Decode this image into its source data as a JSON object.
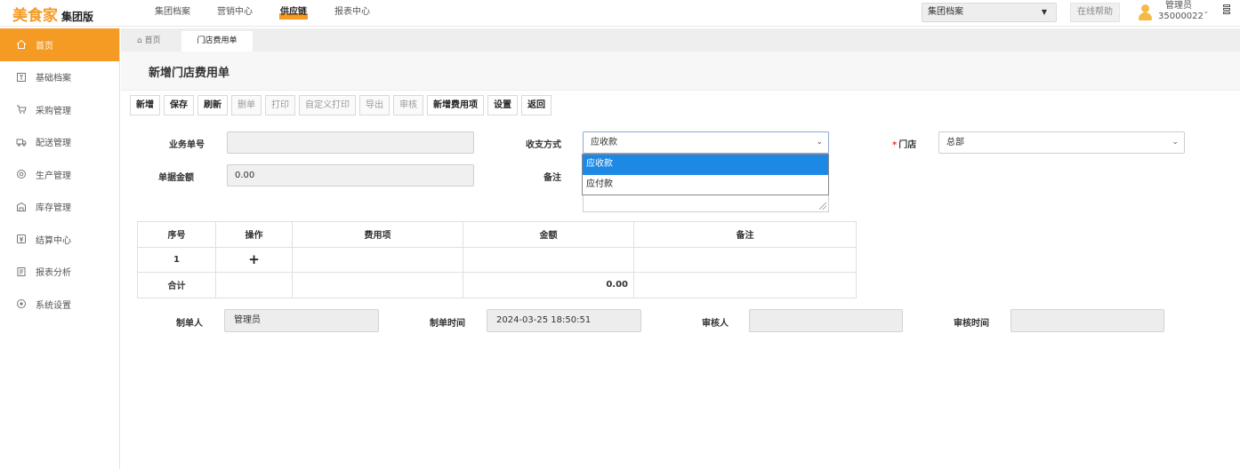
{
  "brand": {
    "name": "美食家",
    "edition": "集团版"
  },
  "top_nav": [
    {
      "label": "集团档案",
      "active": false
    },
    {
      "label": "营销中心",
      "active": false
    },
    {
      "label": "供应链",
      "active": true
    },
    {
      "label": "报表中心",
      "active": false
    }
  ],
  "org_select": {
    "value": "集团档案"
  },
  "help_button": "在线帮助",
  "user": {
    "role": "管理员",
    "id": "35000022"
  },
  "sidebar": {
    "items": [
      {
        "label": "首页",
        "icon": "home-icon",
        "active": true
      },
      {
        "label": "基础档案",
        "icon": "archive-icon",
        "active": false
      },
      {
        "label": "采购管理",
        "icon": "cart-icon",
        "active": false
      },
      {
        "label": "配送管理",
        "icon": "truck-icon",
        "active": false
      },
      {
        "label": "生产管理",
        "icon": "factory-icon",
        "active": false
      },
      {
        "label": "库存管理",
        "icon": "warehouse-icon",
        "active": false
      },
      {
        "label": "结算中心",
        "icon": "settlement-icon",
        "active": false
      },
      {
        "label": "报表分析",
        "icon": "report-icon",
        "active": false
      },
      {
        "label": "系统设置",
        "icon": "settings-icon",
        "active": false
      }
    ]
  },
  "tabs": {
    "home": "首页",
    "current": "门店费用单"
  },
  "page": {
    "title": "新增门店费用单"
  },
  "toolbar": {
    "buttons": [
      {
        "label": "新增",
        "enabled": true
      },
      {
        "label": "保存",
        "enabled": true
      },
      {
        "label": "刷新",
        "enabled": true
      },
      {
        "label": "删单",
        "enabled": false
      },
      {
        "label": "打印",
        "enabled": false
      },
      {
        "label": "自定义打印",
        "enabled": false
      },
      {
        "label": "导出",
        "enabled": false
      },
      {
        "label": "审核",
        "enabled": false
      },
      {
        "label": "新增费用项",
        "enabled": true
      },
      {
        "label": "设置",
        "enabled": true
      },
      {
        "label": "返回",
        "enabled": true
      }
    ]
  },
  "form": {
    "doc_no": {
      "label": "业务单号",
      "value": ""
    },
    "doc_amount": {
      "label": "单据金额",
      "value": "0.00"
    },
    "payment_type": {
      "label": "收支方式",
      "value": "应收款",
      "options": [
        "应收款",
        "应付款"
      ],
      "highlighted": "应收款"
    },
    "remark": {
      "label": "备注",
      "value": ""
    },
    "store": {
      "label": "门店",
      "required_mark": "*",
      "value": "总部"
    }
  },
  "table": {
    "headers": [
      "序号",
      "操作",
      "费用项",
      "金额",
      "备注"
    ],
    "rows": [
      {
        "seq": "1",
        "action": "+",
        "item": "",
        "amount": "",
        "remark": ""
      }
    ],
    "total_row": {
      "label": "合计",
      "amount": "0.00"
    }
  },
  "footer": {
    "creator": {
      "label": "制单人",
      "value": "管理员"
    },
    "create_time": {
      "label": "制单时间",
      "value": "2024-03-25 18:50:51"
    },
    "auditor": {
      "label": "审核人",
      "value": ""
    },
    "audit_time": {
      "label": "审核时间",
      "value": ""
    }
  },
  "colors": {
    "brand_orange": "#f59a23",
    "dropdown_highlight": "#1e88e5"
  }
}
